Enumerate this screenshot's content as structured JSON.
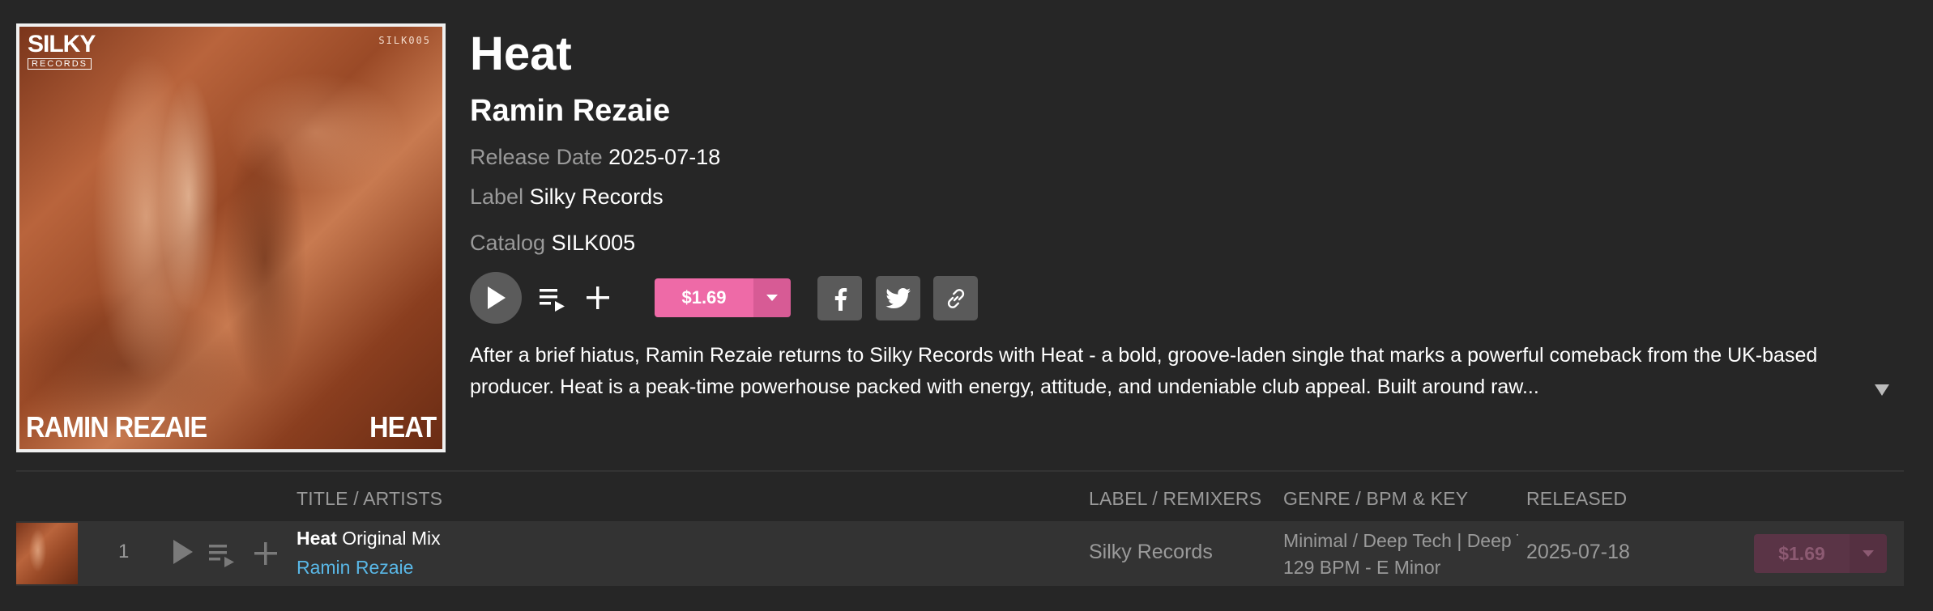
{
  "artwork": {
    "logo_top": "SILKY",
    "logo_bottom": "RECORDS",
    "catalog": "SILK005",
    "artist": "RAMIN REZAIE",
    "title": "HEAT"
  },
  "release": {
    "title": "Heat",
    "artist": "Ramin Rezaie",
    "release_date_label": "Release Date",
    "release_date": "2025-07-18",
    "label_label": "Label",
    "label": "Silky Records",
    "catalog_label": "Catalog",
    "catalog": "SILK005",
    "price": "$1.69",
    "description": "After a brief hiatus, Ramin Rezaie returns to Silky Records with Heat - a bold, groove-laden single that marks a powerful comeback from the UK-based producer. Heat is a peak-time powerhouse packed with energy, attitude, and undeniable club appeal. Built around raw..."
  },
  "actions": {
    "icons": [
      "play-icon",
      "add-to-queue-icon",
      "plus-icon",
      "chevron-down-icon",
      "facebook-icon",
      "twitter-icon",
      "link-icon"
    ]
  },
  "table": {
    "headers": {
      "title": "TITLE / ARTISTS",
      "label": "LABEL / REMIXERS",
      "genre": "GENRE / BPM & KEY",
      "released": "RELEASED"
    },
    "tracks": [
      {
        "number": "1",
        "title": "Heat",
        "mix": "Original Mix",
        "artist": "Ramin Rezaie",
        "label": "Silky Records",
        "genre": "Minimal / Deep Tech | Deep Tech",
        "bpm_key": "129 BPM - E Minor",
        "released": "2025-07-18",
        "price": "$1.69"
      }
    ]
  },
  "colors": {
    "background": "#262626",
    "buy_pink": "#ee6aa7",
    "artist_link": "#59b7e6"
  }
}
